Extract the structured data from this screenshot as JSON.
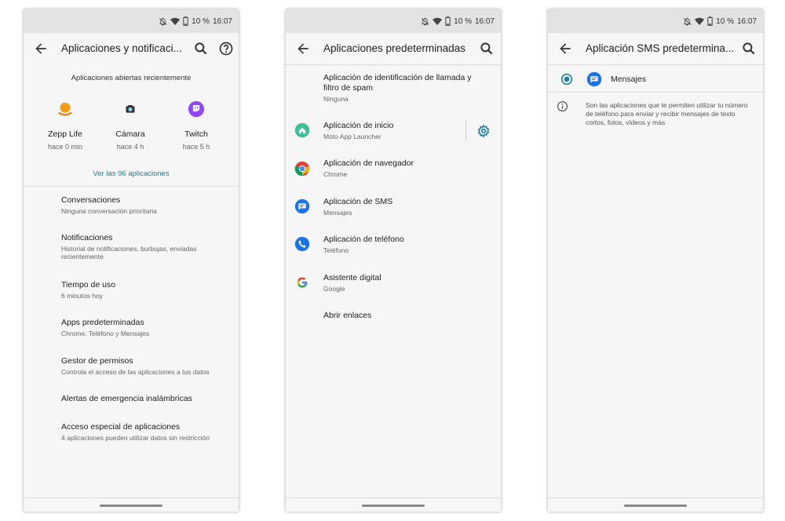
{
  "status": {
    "battery": "10 %",
    "time": "16:07"
  },
  "screen1": {
    "title": "Aplicaciones y notificaci...",
    "recent_header": "Aplicaciones abiertas recientemente",
    "recent": [
      {
        "name": "Zepp Life",
        "time": "hace 0 min"
      },
      {
        "name": "Cámara",
        "time": "hace 4 h"
      },
      {
        "name": "Twitch",
        "time": "hace 5 h"
      }
    ],
    "see_all": "Ver las 96 aplicaciones",
    "items": [
      {
        "title": "Conversaciones",
        "subtitle": "Ninguna conversación prioritaria"
      },
      {
        "title": "Notificaciones",
        "subtitle": "Historial de notificaciones, burbujas, enviadas recientemente"
      },
      {
        "title": "Tiempo de uso",
        "subtitle": "6 minutos hoy"
      },
      {
        "title": "Apps predeterminadas",
        "subtitle": "Chrome, Teléfono y Mensajes"
      },
      {
        "title": "Gestor de permisos",
        "subtitle": "Controla el acceso de las aplicaciones a tus datos"
      },
      {
        "title": "Alertas de emergencia inalámbricas",
        "subtitle": ""
      },
      {
        "title": "Acceso especial de aplicaciones",
        "subtitle": "4 aplicaciones pueden utilizar datos sin restricción"
      }
    ]
  },
  "screen2": {
    "title": "Aplicaciones predeterminadas",
    "items": [
      {
        "title": "Aplicación de identificación de llamada y filtro de spam",
        "subtitle": "Ninguna"
      },
      {
        "title": "Aplicación de inicio",
        "subtitle": "Moto App Launcher"
      },
      {
        "title": "Aplicación de navegador",
        "subtitle": "Chrome"
      },
      {
        "title": "Aplicación de SMS",
        "subtitle": "Mensajes"
      },
      {
        "title": "Aplicación de teléfono",
        "subtitle": "Teléfono"
      },
      {
        "title": "Asistente digital",
        "subtitle": "Google"
      },
      {
        "title": "Abrir enlaces",
        "subtitle": ""
      }
    ]
  },
  "screen3": {
    "title": "Aplicación SMS predetermina...",
    "option": "Mensajes",
    "info": "Son las aplicaciones que te permiten utilizar tu número de teléfono para enviar y recibir mensajes de texto cortos, fotos, vídeos y más"
  },
  "colors": {
    "accent": "#1a7ea0",
    "messages_blue": "#1a73e8"
  }
}
